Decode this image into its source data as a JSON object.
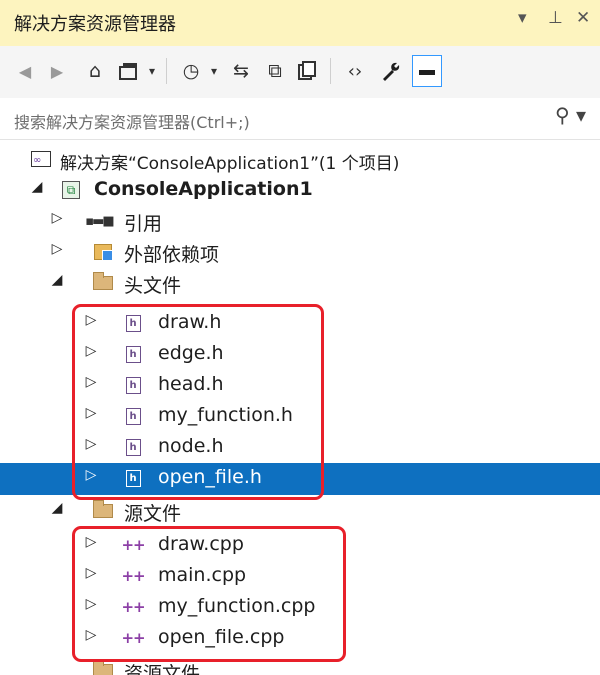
{
  "panel": {
    "title": "解决方案资源管理器",
    "controls": {
      "dropdown": "▾",
      "pin": "⊥",
      "close": "✕"
    }
  },
  "toolbar": {
    "icons": [
      "back-icon",
      "forward-icon",
      "home-icon",
      "switch-views-icon",
      "dropdown-icon",
      "pending-changes-icon",
      "dropdown-icon",
      "sync-icon",
      "collapse-all-icon",
      "show-all-files-icon",
      "view-code-icon",
      "properties-icon",
      "preview-icon"
    ]
  },
  "search": {
    "placeholder": "搜索解决方案资源管理器(Ctrl+;)",
    "icon": "search-icon"
  },
  "tree": {
    "solution": {
      "label": "解决方案“ConsoleApplication1”(1 个项目)"
    },
    "project": {
      "label": "ConsoleApplication1"
    },
    "references": {
      "label": "引用"
    },
    "external_deps": {
      "label": "外部依赖项"
    },
    "headers_folder": {
      "label": "头文件"
    },
    "headers": [
      {
        "label": "draw.h"
      },
      {
        "label": "edge.h"
      },
      {
        "label": "head.h"
      },
      {
        "label": "my_function.h"
      },
      {
        "label": "node.h"
      },
      {
        "label": "open_file.h",
        "selected": true
      }
    ],
    "sources_folder": {
      "label": "源文件"
    },
    "sources": [
      {
        "label": "draw.cpp"
      },
      {
        "label": "main.cpp"
      },
      {
        "label": "my_function.cpp"
      },
      {
        "label": "open_file.cpp"
      }
    ],
    "resources_folder": {
      "label": "资源文件"
    }
  },
  "colors": {
    "title_bg": "#fdf4bf",
    "selected_bg": "#0e70c0",
    "highlight_box": "#e8202a"
  }
}
